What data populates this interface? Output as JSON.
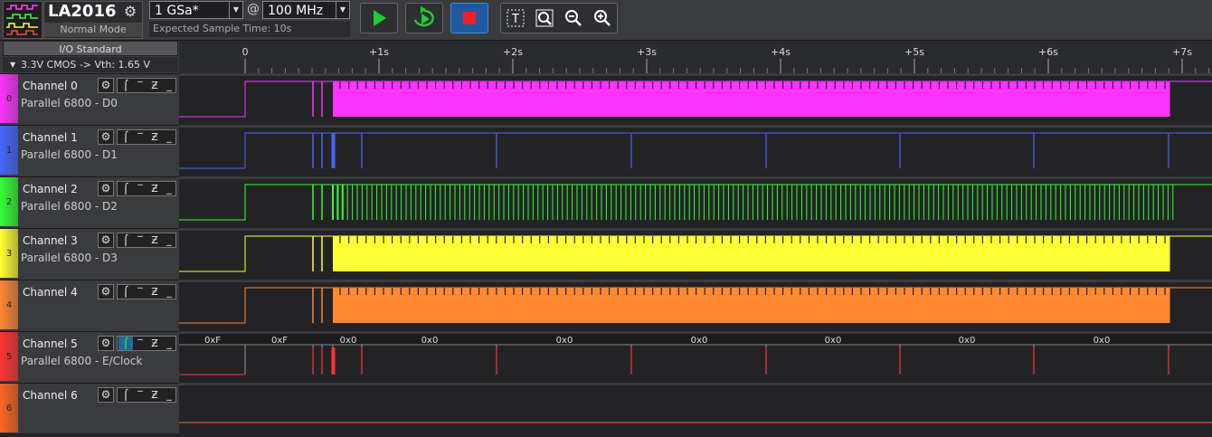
{
  "toolbar": {
    "device_name": "LA2016",
    "device_mode": "Normal Mode",
    "sample_rate": "1 GSa*",
    "at_symbol": "@",
    "bandwidth": "100 MHz",
    "expected_sample_time": "Expected Sample Time: 10s",
    "buttons": [
      "play",
      "loop",
      "stop"
    ],
    "tools": [
      "text-tool",
      "zoom-tool",
      "zoom-out",
      "zoom-in"
    ]
  },
  "sidebar": {
    "io_standard_label": "I/O Standard",
    "io_standard_value": "3.3V CMOS -> Vth: 1.65 V"
  },
  "timeline": {
    "labels": [
      "0",
      "+1s",
      "+2s",
      "+3s",
      "+4s",
      "+5s",
      "+6s",
      "+7s"
    ]
  },
  "channels": [
    {
      "name": "Channel 0",
      "sub": "Parallel 6800 - D0",
      "num": "0",
      "color": "#ff33ff"
    },
    {
      "name": "Channel 1",
      "sub": "Parallel 6800 - D1",
      "num": "1",
      "color": "#4466ff"
    },
    {
      "name": "Channel 2",
      "sub": "Parallel 6800 - D2",
      "num": "2",
      "color": "#33ff33"
    },
    {
      "name": "Channel 3",
      "sub": "Parallel 6800 - D3",
      "num": "3",
      "color": "#ffff33"
    },
    {
      "name": "Channel 4",
      "sub": "",
      "num": "4",
      "color": "#ff8833"
    },
    {
      "name": "Channel 5",
      "sub": "Parallel 6800 - E/Clock",
      "num": "5",
      "color": "#ff3333"
    },
    {
      "name": "Channel 6",
      "sub": "",
      "num": "6",
      "color": "#ff6622"
    }
  ],
  "decode_labels": [
    "0xF",
    "0xF",
    "0x0",
    "0x0",
    "0x0",
    "0x0",
    "0x0",
    "0x0",
    "0x0"
  ],
  "icons": {
    "gear": "⚙",
    "rising": "⎍",
    "high": "‾",
    "falling": "↯",
    "low": "_"
  }
}
